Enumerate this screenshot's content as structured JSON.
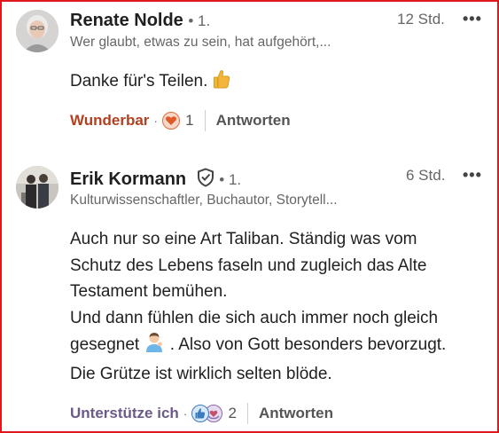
{
  "comments": [
    {
      "name": "Renate Nolde",
      "degree": "• 1.",
      "subtitle": "Wer glaubt, etwas zu sein, hat aufgehört,...",
      "time": "12 Std.",
      "more": "•••",
      "body": "Danke für's Teilen.",
      "reaction_label": "Wunderbar",
      "reaction_color": "#b24020",
      "dot": "·",
      "reaction_count": "1",
      "reply_label": "Antworten"
    },
    {
      "name": "Erik Kormann",
      "degree": "• 1.",
      "subtitle": "Kulturwissenschaftler, Buchautor, Storytell...",
      "time": "6 Std.",
      "more": "•••",
      "body_lines": [
        "Auch nur so eine Art Taliban. Ständig was vom",
        "Schutz des Lebens faseln und zugleich das Alte",
        "Testament bemühen.",
        "Und dann fühlen die sich auch immer noch gleich",
        "gesegnet",
        ". Also von Gott besonders bevorzugt.",
        "Die Grütze ist wirklich selten blöde."
      ],
      "reaction_label": "Unterstütze ich",
      "reaction_color": "#6b5a8a",
      "dot": "·",
      "reaction_count": "2",
      "reply_label": "Antworten"
    }
  ]
}
